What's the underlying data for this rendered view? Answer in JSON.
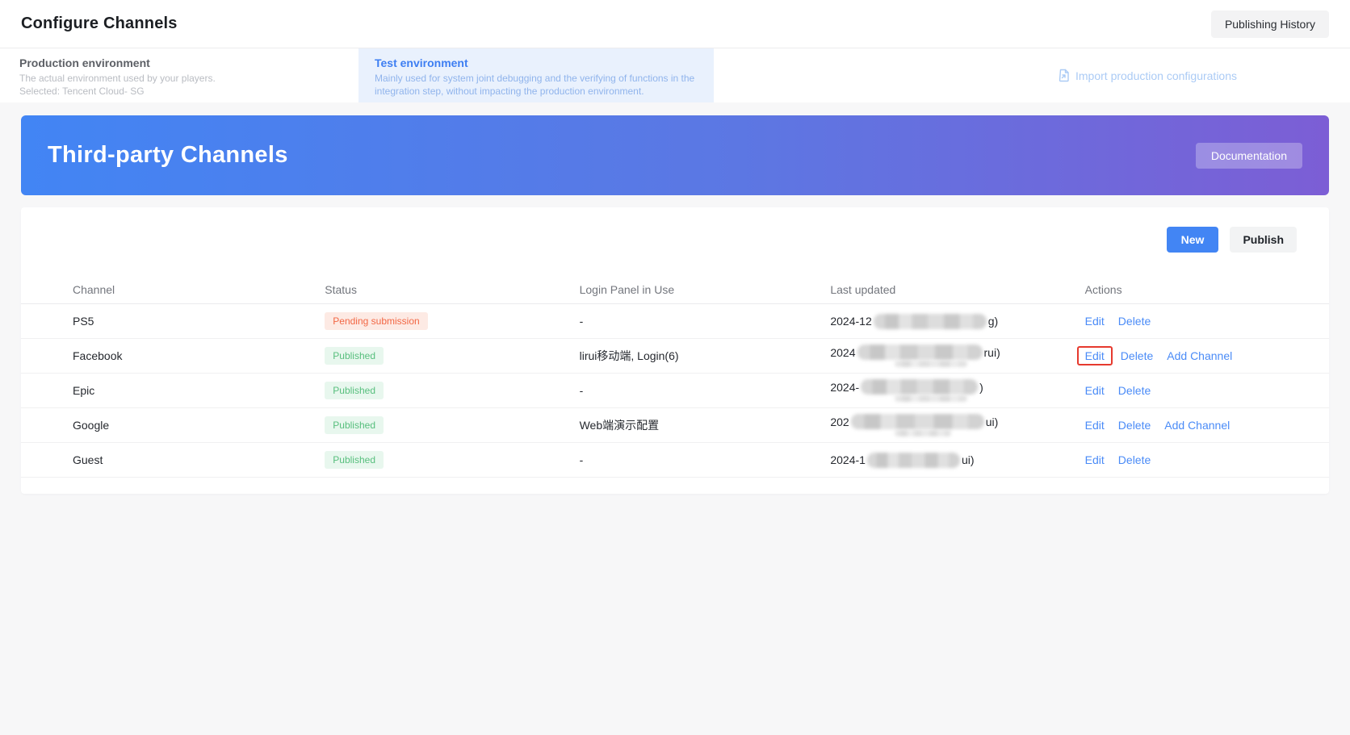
{
  "page": {
    "title": "Configure Channels",
    "publishing_history_label": "Publishing History"
  },
  "environments": {
    "production": {
      "title": "Production environment",
      "line1": "The actual environment used by your players.",
      "line2": "Selected: Tencent Cloud- SG"
    },
    "test": {
      "title": "Test environment",
      "line1": "Mainly used for system joint debugging and the verifying of functions in the",
      "line2": "integration step, without impacting the production environment."
    },
    "import_label": "Import production configurations"
  },
  "banner": {
    "title": "Third-party Channels",
    "doc_button": "Documentation"
  },
  "toolbar": {
    "new_label": "New",
    "publish_label": "Publish"
  },
  "table": {
    "headers": [
      "Channel",
      "Status",
      "Login Panel in Use",
      "Last updated",
      "Actions"
    ],
    "rows": [
      {
        "channel": "PS5",
        "status": "Pending submission",
        "status_type": "pending",
        "login_panel": "-",
        "date_prefix": "2024-12",
        "date_suffix": "g)",
        "blur_w": 140,
        "blur2_w": 0,
        "actions": [
          "Edit",
          "Delete"
        ],
        "highlight_edit": false
      },
      {
        "channel": "Facebook",
        "status": "Published",
        "status_type": "published",
        "login_panel": "lirui移动端, Login(6)",
        "date_prefix": "2024",
        "date_suffix": "rui)",
        "blur_w": 155,
        "blur2_w": 90,
        "actions": [
          "Edit",
          "Delete",
          "Add Channel"
        ],
        "highlight_edit": true
      },
      {
        "channel": "Epic",
        "status": "Published",
        "status_type": "published",
        "login_panel": "-",
        "date_prefix": "2024-",
        "date_suffix": ")",
        "blur_w": 145,
        "blur2_w": 90,
        "actions": [
          "Edit",
          "Delete"
        ],
        "highlight_edit": false
      },
      {
        "channel": "Google",
        "status": "Published",
        "status_type": "published",
        "login_panel": "Web端演示配置",
        "date_prefix": "202",
        "date_suffix": "ui)",
        "blur_w": 165,
        "blur2_w": 70,
        "actions": [
          "Edit",
          "Delete",
          "Add Channel"
        ],
        "highlight_edit": false
      },
      {
        "channel": "Guest",
        "status": "Published",
        "status_type": "published",
        "login_panel": "-",
        "date_prefix": "2024-1",
        "date_suffix": "ui)",
        "blur_w": 115,
        "blur2_w": 0,
        "actions": [
          "Edit",
          "Delete"
        ],
        "highlight_edit": false
      }
    ]
  },
  "colors": {
    "accent_blue": "#4285f4",
    "banner_gradient_start": "#4285f4",
    "banner_gradient_end": "#7c5ed5",
    "link_blue": "#4a8bf7",
    "pending_text": "#f26744",
    "pending_bg": "#fdeae4",
    "published_text": "#57bf7d",
    "published_bg": "#e8f7ee",
    "highlight_red": "#e63a2e",
    "test_env_bg": "#e9f1fd"
  }
}
